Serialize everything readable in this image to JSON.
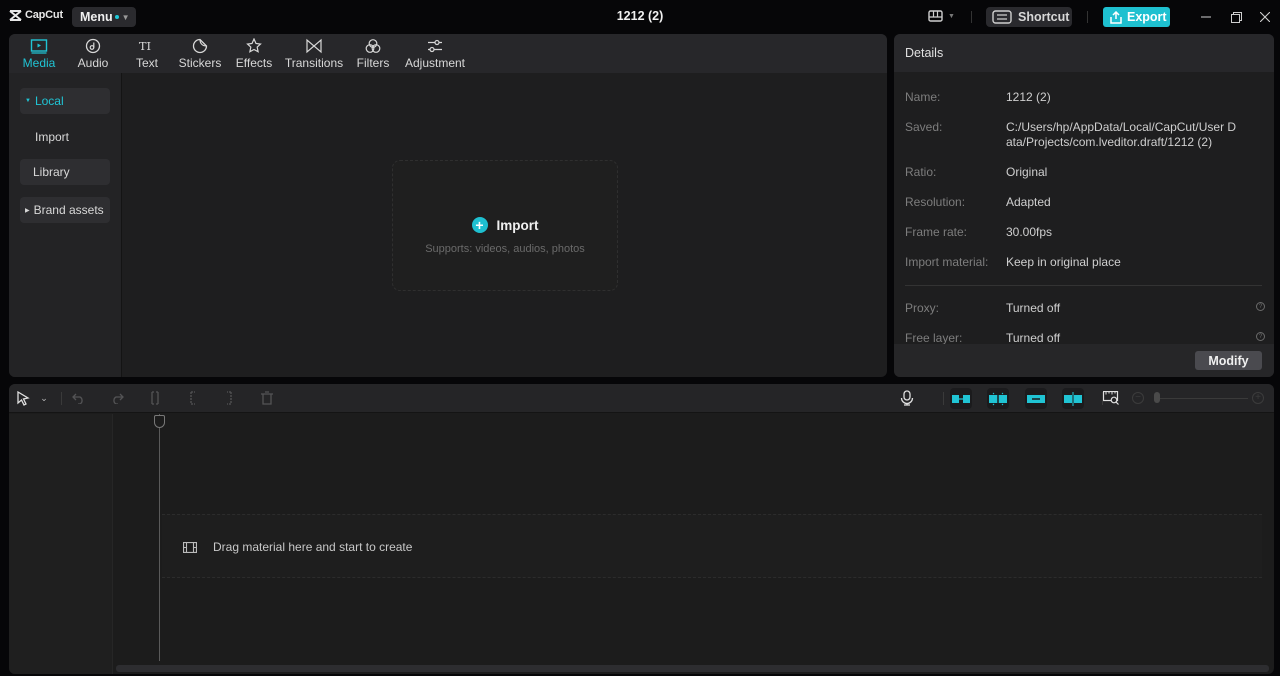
{
  "app": {
    "logo_text": "CapCut",
    "menu_label": "Menu",
    "project_title": "1212 (2)",
    "shortcut_label": "Shortcut",
    "export_label": "Export",
    "accent_color": "#1ec0d0"
  },
  "media_tabs": [
    {
      "label": "Media",
      "icon": "media-icon",
      "active": true
    },
    {
      "label": "Audio",
      "icon": "audio-icon"
    },
    {
      "label": "Text",
      "icon": "text-icon"
    },
    {
      "label": "Stickers",
      "icon": "stickers-icon"
    },
    {
      "label": "Effects",
      "icon": "effects-icon"
    },
    {
      "label": "Transitions",
      "icon": "transitions-icon"
    },
    {
      "label": "Filters",
      "icon": "filters-icon"
    },
    {
      "label": "Adjustment",
      "icon": "adjustment-icon"
    }
  ],
  "sidebar": {
    "items": [
      {
        "label": "Local",
        "expanded": true,
        "active": true
      },
      {
        "label": "Import"
      },
      {
        "label": "Library"
      },
      {
        "label": "Brand assets",
        "expandable": true
      }
    ]
  },
  "import_area": {
    "label": "Import",
    "subtitle": "Supports: videos, audios, photos"
  },
  "details": {
    "title": "Details",
    "rows": [
      {
        "key": "Name:",
        "value": "1212 (2)"
      },
      {
        "key": "Saved:",
        "value": "C:/Users/hp/AppData/Local/CapCut/User Data/Projects/com.lveditor.draft/1212 (2)"
      },
      {
        "key": "Ratio:",
        "value": "Original"
      },
      {
        "key": "Resolution:",
        "value": "Adapted"
      },
      {
        "key": "Frame rate:",
        "value": "30.00fps"
      },
      {
        "key": "Import material:",
        "value": "Keep in original place"
      },
      {
        "key": "Proxy:",
        "value": "Turned off"
      },
      {
        "key": "Free layer:",
        "value": "Turned off"
      }
    ],
    "modify_label": "Modify"
  },
  "timeline": {
    "drop_hint": "Drag material here and start to create"
  }
}
